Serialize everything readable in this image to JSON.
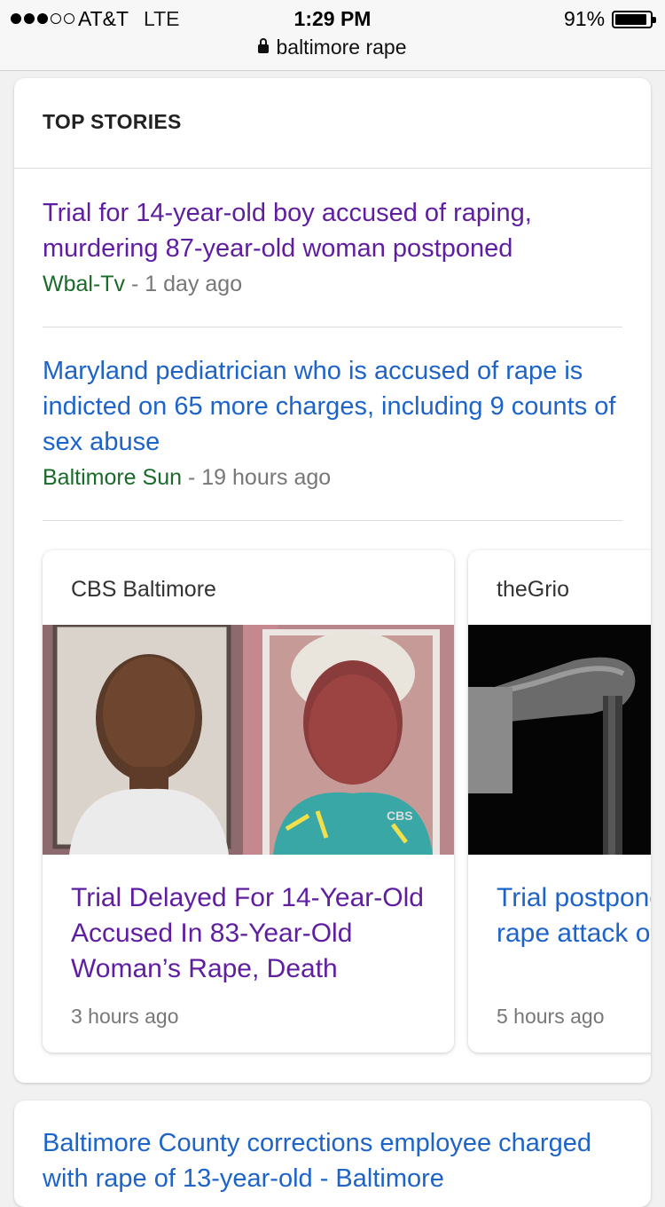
{
  "status_bar": {
    "signal_dots": [
      true,
      true,
      true,
      false,
      false
    ],
    "carrier": "AT&T",
    "network": "LTE",
    "time": "1:29 PM",
    "battery_percent_label": "91%",
    "battery_level": 0.91
  },
  "url_bar": {
    "text": "baltimore rape"
  },
  "top_stories": {
    "header": "TOP STORIES",
    "stories": [
      {
        "title": "Trial for 14-year-old boy accused of raping, murdering 87-year-old woman postponed",
        "source": "Wbal-Tv",
        "separator": "-",
        "time": "1 day ago",
        "visited": true
      },
      {
        "title": "Maryland pediatrician who is accused of rape is indicted on 65 more charges, including 9 counts of sex abuse",
        "source": "Baltimore Sun",
        "separator": "-",
        "time": "19 hours ago",
        "visited": false
      }
    ],
    "carousel": [
      {
        "source": "CBS Baltimore",
        "title": "Trial Delayed For 14-Year-Old Accused In 83-Year-Old Woman’s Rape, Death",
        "time": "3 hours ago",
        "image_alt": "mugshot-photos",
        "watermark": "CBS"
      },
      {
        "source": "theGrio",
        "title": "Trial postponed Baltimore teen rape attack of",
        "time": "5 hours ago",
        "image_alt": "hand-on-cane-photo"
      }
    ]
  },
  "next_result": {
    "title": "Baltimore County corrections employee charged with rape of 13-year-old - Baltimore"
  },
  "colors": {
    "visited_link": "#5f1ea0",
    "link": "#1e64c8",
    "source_green": "#1a6a2a",
    "meta_gray": "#777777"
  }
}
